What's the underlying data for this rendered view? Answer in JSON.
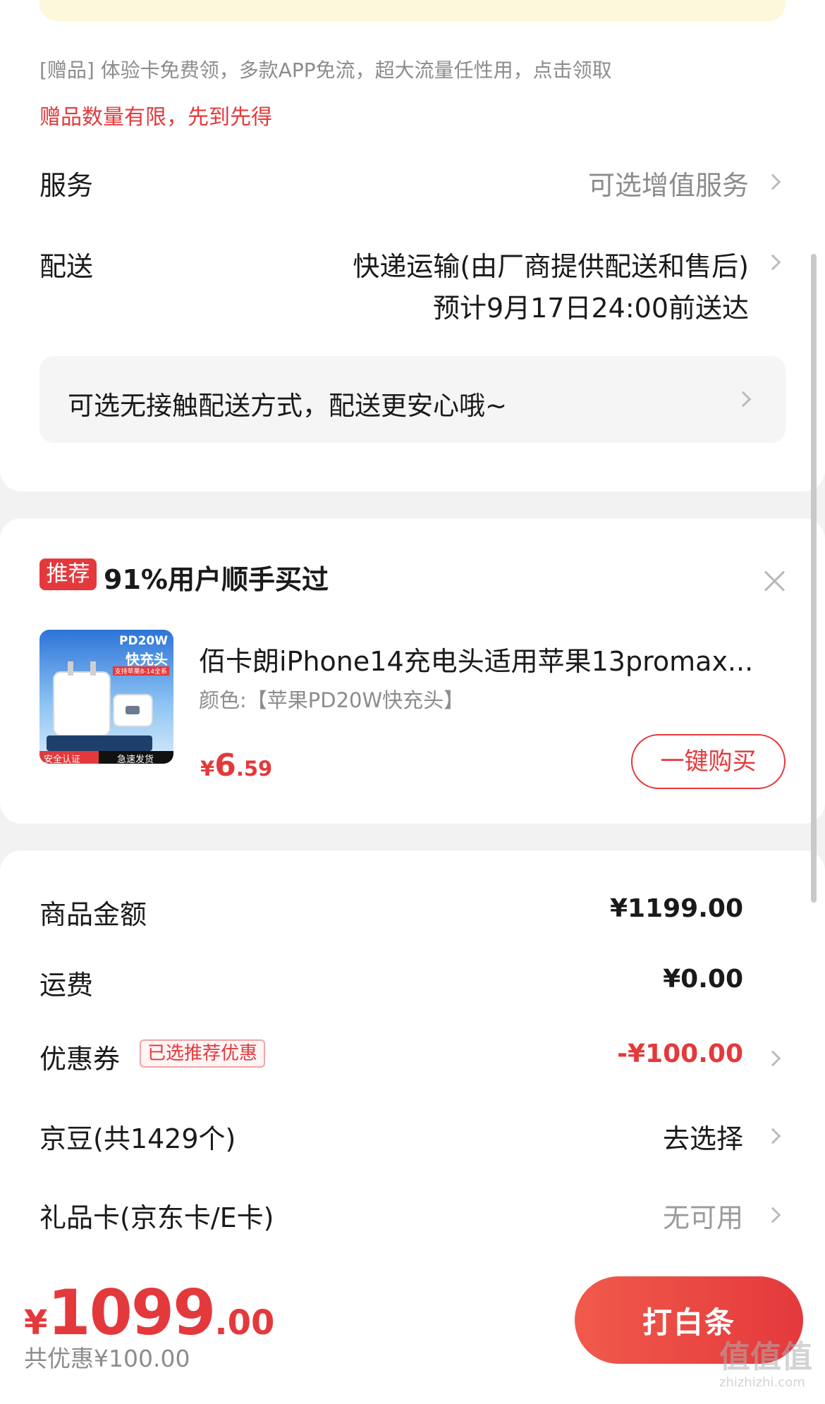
{
  "gift": {
    "text": "[赠品] 体验卡免费领，多款APP免流，超大流量任性用，点击领取",
    "warning": "赠品数量有限，先到先得"
  },
  "service": {
    "label": "服务",
    "value": "可选增值服务"
  },
  "delivery": {
    "label": "配送",
    "method": "快递运输(由厂商提供配送和售后)",
    "estimate": "预计9月17日24:00前送达",
    "contactless": "可选无接触配送方式，配送更安心哦~"
  },
  "recommend": {
    "badge": "推荐",
    "title": "91%用户顺手买过",
    "product": {
      "name": "佰卡朗iPhone14充电头适用苹果13promax...",
      "color": "颜色:【苹果PD20W快充头】",
      "image_text_1": "PD20W",
      "image_text_2": "快充头",
      "image_text_3": "支持苹果8-14全系",
      "image_text_4": "安全认证",
      "image_text_5": "急速发货",
      "price_symbol": "¥",
      "price_int": "6",
      "price_dec": ".59"
    },
    "buy_button": "一键购买"
  },
  "summary": {
    "goods_label": "商品金额",
    "goods_value": "¥1199.00",
    "shipping_label": "运费",
    "shipping_value": "¥0.00",
    "coupon_label": "优惠券",
    "coupon_tag": "已选推荐优惠",
    "coupon_value": "-¥100.00",
    "jingdou_label": "京豆(共1429个)",
    "jingdou_value": "去选择",
    "giftcard_label": "礼品卡(京东卡/E卡)",
    "giftcard_value": "无可用"
  },
  "footer": {
    "total_symbol": "¥",
    "total_int": "1099",
    "total_dec": ".00",
    "discount": "共优惠¥100.00",
    "pay_button": "打白条",
    "watermark_top": "值值值",
    "watermark_bottom": "zhizhizhi.com"
  },
  "colors": {
    "accent": "#e4393c",
    "muted": "#8c8c8c"
  }
}
